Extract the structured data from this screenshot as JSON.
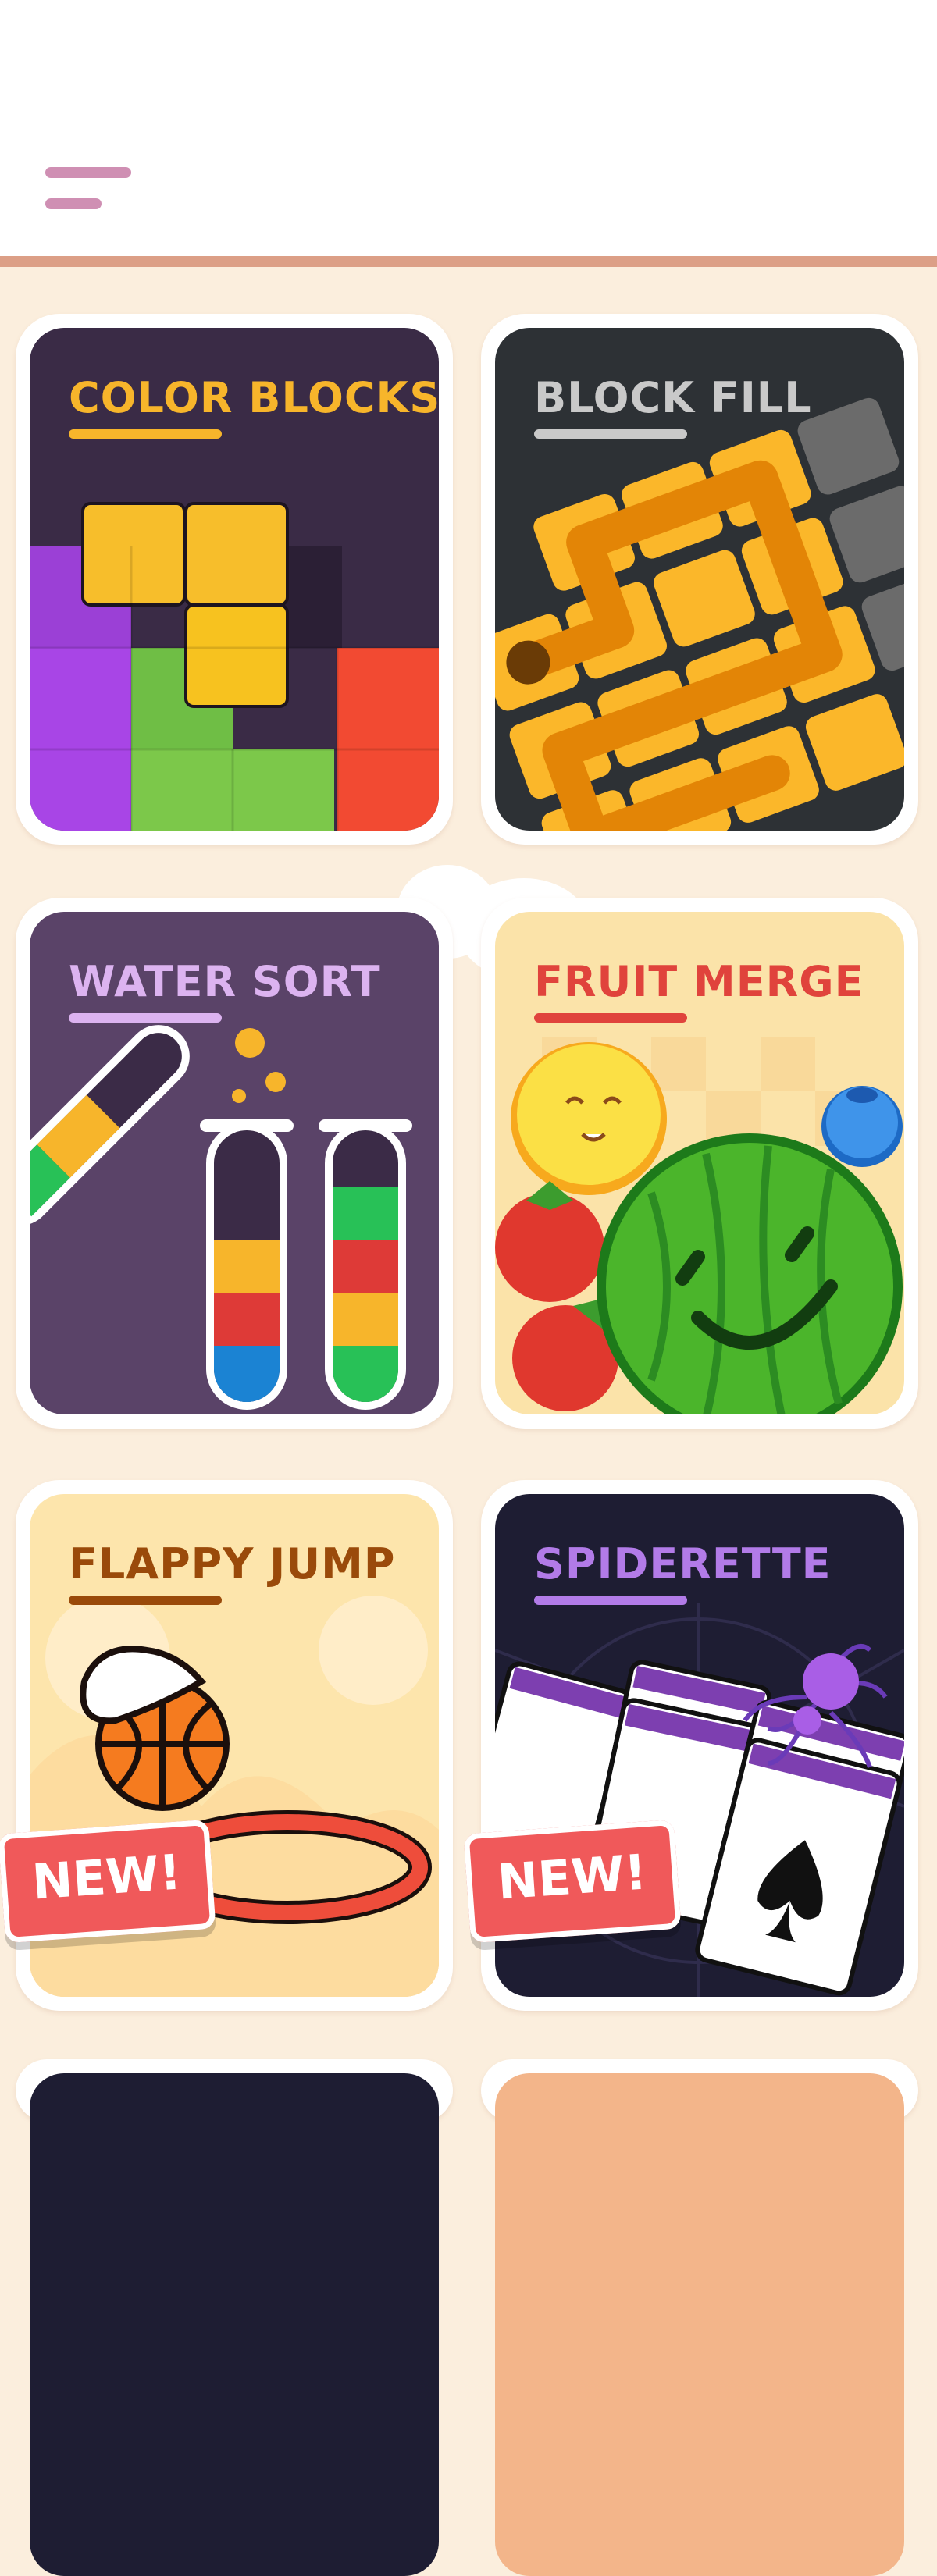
{
  "header": {
    "menu_icon": "hamburger-menu-icon"
  },
  "colors": {
    "header_line": "#dc9f86",
    "page_bg": "#fbeedd",
    "menu_icon": "#cf8fb3",
    "badge": "#f0595a"
  },
  "games": [
    {
      "title": "COLOR BLOCKS",
      "title_color": "#f7b52b",
      "bg": "#3a2b46"
    },
    {
      "title": "BLOCK FILL",
      "title_color": "#c9c9c9",
      "bg": "#2d3135"
    },
    {
      "title": "WATER SORT",
      "title_color": "#dcb3f0",
      "bg": "#5a4368"
    },
    {
      "title": "FRUIT MERGE",
      "title_color": "#e0433c",
      "bg": "#fbe3a9"
    },
    {
      "title": "FLAPPY JUMP",
      "title_color": "#9a4a0a",
      "bg": "#fde5ac",
      "badge": "NEW!"
    },
    {
      "title": "SPIDERETTE",
      "title_color": "#b27be8",
      "bg": "#1e1d33",
      "badge": "NEW!"
    }
  ]
}
